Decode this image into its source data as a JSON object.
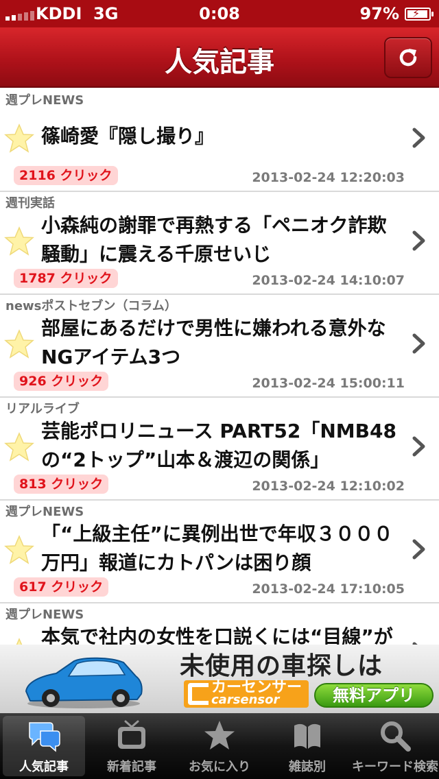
{
  "status_bar": {
    "carrier": "KDDI",
    "network": "3G",
    "time": "0:08",
    "battery": "97%"
  },
  "nav": {
    "title": "人気記事"
  },
  "articles": [
    {
      "source": "週プレNEWS",
      "title": "篠崎愛『隠し撮り』",
      "clicks": "2116 クリック",
      "date": "2013-02-24 12:20:03"
    },
    {
      "source": "週刊実話",
      "title": "小森純の謝罪で再熱する「ペニオク詐欺騒動」に震える千原せいじ",
      "clicks": "1787 クリック",
      "date": "2013-02-24 14:10:07"
    },
    {
      "source": "newsポストセブン（コラム）",
      "title": "部屋にあるだけで男性に嫌われる意外なNGアイテム3つ",
      "clicks": "926 クリック",
      "date": "2013-02-24 15:00:11"
    },
    {
      "source": "リアルライブ",
      "title": "芸能ポロリニュース PART52「NMB48の“2トップ”山本＆渡辺の関係」",
      "clicks": "813 クリック",
      "date": "2013-02-24 12:10:02"
    },
    {
      "source": "週プレNEWS",
      "title": "「“上級主任”に異例出世で年収３０００万円」報道にカトパンは困り顔",
      "clicks": "617 クリック",
      "date": "2013-02-24 17:10:05"
    },
    {
      "source": "週プレNEWS",
      "title": "本気で社内の女性を口説くには“目線”が",
      "clicks": "",
      "date": ""
    }
  ],
  "ad": {
    "headline": "未使用の車探しは",
    "brand_jp": "カーセンサー",
    "brand_en": "carsensor",
    "cta": "無料アプリ"
  },
  "tabs": [
    {
      "label": "人気記事",
      "icon": "chat-bubbles-icon",
      "active": true
    },
    {
      "label": "新着記事",
      "icon": "tv-icon",
      "active": false
    },
    {
      "label": "お気に入り",
      "icon": "star-icon",
      "active": false
    },
    {
      "label": "雑誌別",
      "icon": "book-icon",
      "active": false
    },
    {
      "label": "キーワード検索",
      "icon": "search-icon",
      "active": false
    }
  ],
  "colors": {
    "accent_red": "#b0121a",
    "click_badge_bg": "#ffd5d5",
    "click_badge_text": "#e0131b"
  }
}
